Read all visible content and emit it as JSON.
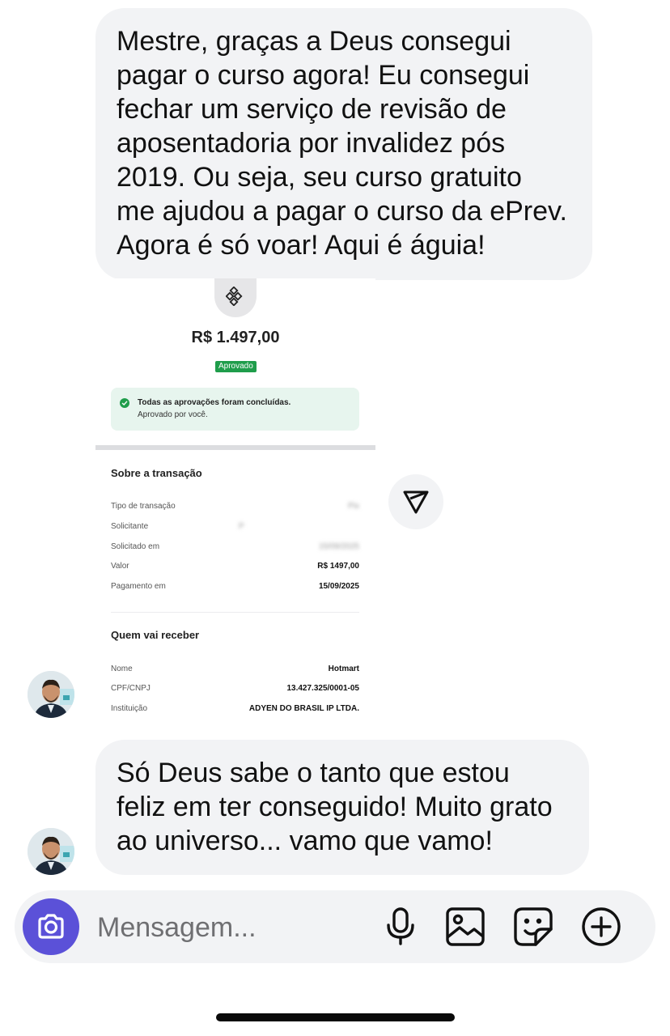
{
  "messages": [
    {
      "text": "Mestre, graças a Deus consegui\npagar o curso agora! Eu consegui\nfechar um serviço de revisão de\naposentadoria por invalidez pós\n2019. Ou seja, seu curso gratuito\nme ajudou a pagar o curso da ePrev.\nAgora é só voar! Aqui é águia!"
    },
    {
      "text": "Só Deus sabe o tanto que estou\nfeliz em ter conseguido! Muito grato\nao universo... vamo que vamo!"
    }
  ],
  "receipt": {
    "amount": "R$ 1.497,00",
    "status_tag": "Aprovado",
    "notice_title": "Todas as aprovações foram concluídas.",
    "notice_subtitle": "Aprovado por você.",
    "transaction_title": "Sobre a transação",
    "transaction_rows": [
      {
        "label": "Tipo de transação",
        "value": "Pix",
        "obscured": true
      },
      {
        "label": "Solicitante",
        "value": "P",
        "obscured": true
      },
      {
        "label": "Solicitado em",
        "value": "15/09/2025",
        "obscured": true
      },
      {
        "label": "Valor",
        "value": "R$ 1497,00",
        "obscured": false
      },
      {
        "label": "Pagamento em",
        "value": "15/09/2025",
        "obscured": false
      }
    ],
    "recipient_title": "Quem vai receber",
    "recipient_rows": [
      {
        "label": "Nome",
        "value": "Hotmart"
      },
      {
        "label": "CPF/CNPJ",
        "value": "13.427.325/0001-05"
      },
      {
        "label": "Instituição",
        "value": "ADYEN DO BRASIL IP LTDA."
      }
    ]
  },
  "composer": {
    "placeholder": "Mensagem..."
  },
  "icons": {
    "camera": "camera-icon",
    "mic": "microphone-icon",
    "gallery": "image-icon",
    "sticker": "sticker-icon",
    "plus": "plus-circle-icon",
    "share": "send-icon"
  },
  "colors": {
    "bubble": "#f2f3f5",
    "camera_button": "#5b51d8",
    "approved_green": "#1f9d4b",
    "notice_bg": "#e7f5ee"
  }
}
